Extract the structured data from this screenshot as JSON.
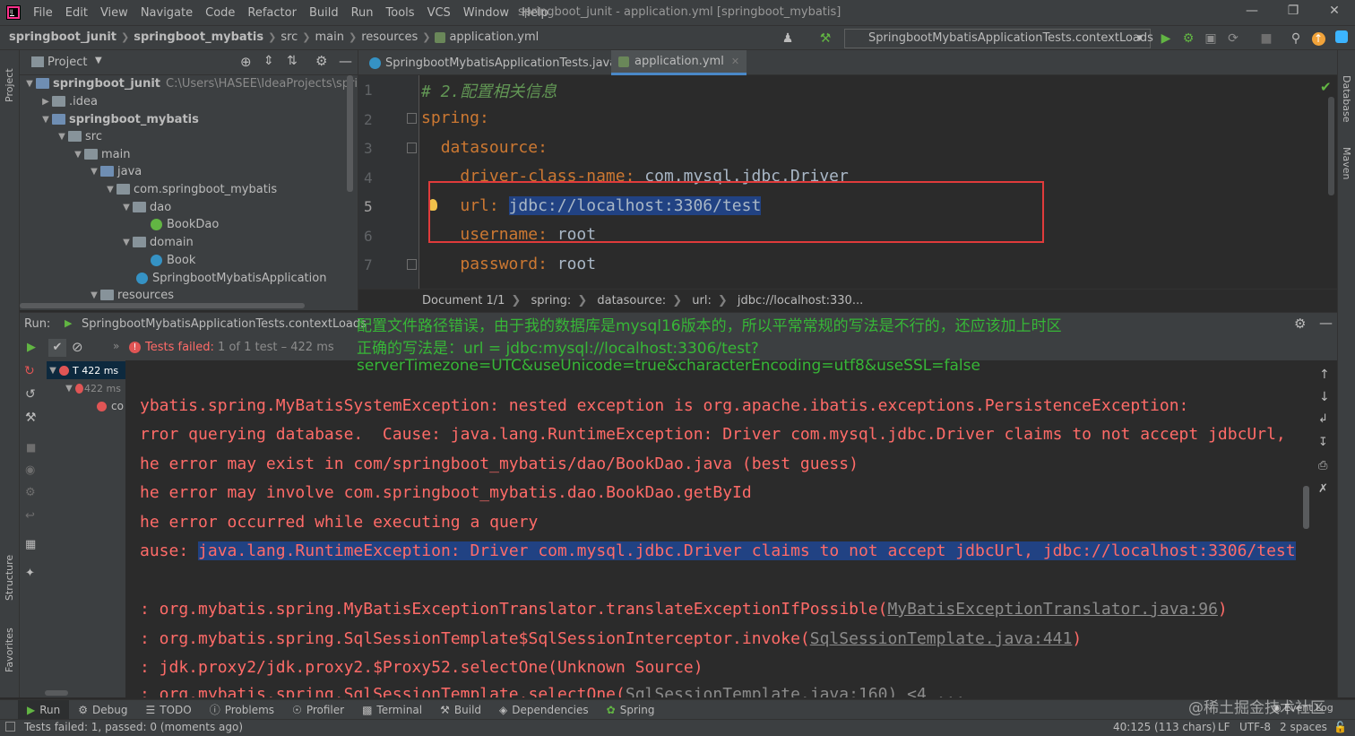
{
  "menu": [
    "File",
    "Edit",
    "View",
    "Navigate",
    "Code",
    "Refactor",
    "Build",
    "Run",
    "Tools",
    "VCS",
    "Window",
    "Help"
  ],
  "window_title": "springboot_junit - application.yml [springboot_mybatis]",
  "breadcrumb": [
    "springboot_junit",
    "springboot_mybatis",
    "src",
    "main",
    "resources",
    "application.yml"
  ],
  "run_config": "SpringbootMybatisApplicationTests.contextLoads",
  "left_strip": {
    "project": "Project",
    "structure": "Structure",
    "favorites": "Favorites"
  },
  "right_strip": {
    "database": "Database",
    "maven": "Maven"
  },
  "project_panel": {
    "title": "Project",
    "tree": [
      {
        "label": "springboot_junit",
        "path": "C:\\Users\\HASEE\\IdeaProjects\\springboo"
      },
      {
        "label": ".idea"
      },
      {
        "label": "springboot_mybatis"
      },
      {
        "label": "src"
      },
      {
        "label": "main"
      },
      {
        "label": "java"
      },
      {
        "label": "com.springboot_mybatis"
      },
      {
        "label": "dao"
      },
      {
        "label": "BookDao"
      },
      {
        "label": "domain"
      },
      {
        "label": "Book"
      },
      {
        "label": "SpringbootMybatisApplication"
      },
      {
        "label": "resources"
      }
    ]
  },
  "editor": {
    "tabs": [
      "SpringbootMybatisApplicationTests.java",
      "application.yml"
    ],
    "line_numbers": [
      "1",
      "2",
      "3",
      "4",
      "5",
      "6",
      "7"
    ],
    "comment": "# 2.配置相关信息",
    "spring_key": "spring",
    "datasource_key": "datasource",
    "driver_key": "driver-class-name",
    "driver_value": "com.mysql.jdbc.Driver",
    "url_key": "url",
    "url_value": "jdbc://localhost:3306/test",
    "username_key": "username",
    "username_value": "root",
    "password_key": "password",
    "password_value": "root",
    "breadcrumb": [
      "Document 1/1",
      "spring:",
      "datasource:",
      "url:",
      "jdbc://localhost:330..."
    ]
  },
  "run": {
    "label": "Run:",
    "tab": "SpringbootMybatisApplicationTests.contextLoads",
    "status_prefix": "Tests failed:",
    "status_rest": "1 of 1 test – 422 ms",
    "tree": [
      {
        "label": "T 422 ms"
      },
      {
        "label": "422 ms"
      },
      {
        "label": "co"
      }
    ],
    "annotation": [
      "配置文件路径错误，由于我的数据库是mysql16版本的，所以平常常规的写法是不行的，还应该加上时区",
      "正确的写法是：url = jdbc:mysql://localhost:3306/test?",
      "serverTimezone=UTC&useUnicode=true&characterEncoding=utf8&useSSL=false"
    ],
    "console": [
      "ybatis.spring.MyBatisSystemException: nested exception is org.apache.ibatis.exceptions.PersistenceException:",
      "rror querying database.  Cause: java.lang.RuntimeException: Driver com.mysql.jdbc.Driver claims to not accept jdbcUrl,",
      "he error may exist in com/springboot_mybatis/dao/BookDao.java (best guess)",
      "he error may involve com.springboot_mybatis.dao.BookDao.getById",
      "he error occurred while executing a query"
    ],
    "cause_prefix": "ause: ",
    "cause_highlight": "java.lang.RuntimeException: Driver com.mysql.jdbc.Driver claims to not accept jdbcUrl, jdbc://localhost:3306/test",
    "stack": [
      {
        "prefix": ": org.mybatis.spring.MyBatisExceptionTranslator.translateExceptionIfPossible(",
        "link": "MyBatisExceptionTranslator.java:96",
        "suffix": ")"
      },
      {
        "prefix": ": org.mybatis.spring.SqlSessionTemplate$SqlSessionInterceptor.invoke(",
        "link": "SqlSessionTemplate.java:441",
        "suffix": ")"
      },
      {
        "prefix": ": jdk.proxy2/jdk.proxy2.$Proxy52.selectOne(Unknown Source)",
        "link": "",
        "suffix": ""
      },
      {
        "prefix": ": org.mybatis.spring.SqlSessionTemplate.selectOne(",
        "link": "SqlSessionTemplate.java:160",
        "suffix": ") <4 ..."
      }
    ]
  },
  "toolwindows": [
    "Run",
    "Debug",
    "TODO",
    "Problems",
    "Profiler",
    "Terminal",
    "Build",
    "Dependencies",
    "Spring"
  ],
  "event_log": "Event Log",
  "watermark": "@稀土掘金技术社区",
  "statusbar": {
    "message": "Tests failed: 1, passed: 0 (moments ago)",
    "position": "40:125 (113 chars)",
    "line_sep": "LF",
    "encoding": "UTF-8",
    "indent": "2 spaces"
  },
  "colors": {
    "keyword": "#cc7832",
    "comment": "#629755",
    "error_text": "#ff6b68",
    "selection": "#214283",
    "annotation": "#37b637",
    "red_box": "#e03b3b"
  }
}
